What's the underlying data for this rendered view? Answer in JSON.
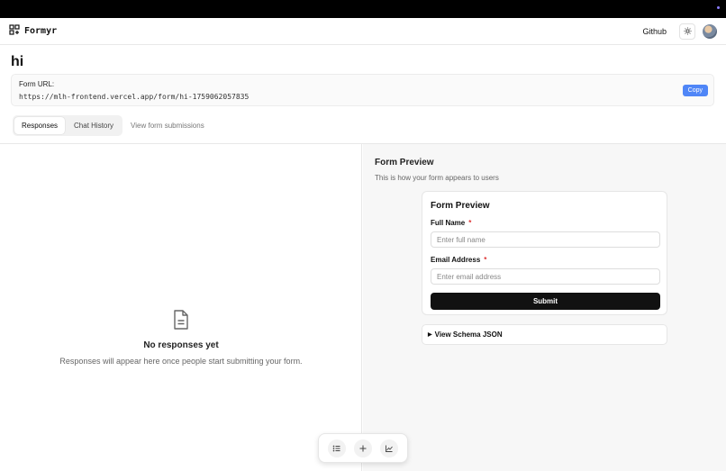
{
  "nav": {
    "brand": "Formyr",
    "github_label": "Github",
    "icons": [
      "grid-plus-icon",
      "sun-icon",
      "avatar"
    ]
  },
  "page": {
    "title": "hi",
    "url_label": "Form URL:",
    "url_value": "https://mlh-frontend.vercel.app/form/hi-1759062057835",
    "copy_label": "Copy"
  },
  "tabs": {
    "items": [
      {
        "label": "Responses",
        "active": true
      },
      {
        "label": "Chat History",
        "active": false
      }
    ],
    "subtitle": "View form submissions"
  },
  "empty_state": {
    "icon": "document-icon",
    "title": "No responses yet",
    "subtitle": "Responses will appear here once people start submitting your form."
  },
  "preview": {
    "title": "Form Preview",
    "subtitle": "This is how your form appears to users",
    "form": {
      "title": "Form Preview",
      "fields": [
        {
          "label": "Full Name",
          "required_mark": "*",
          "placeholder": "Enter full name"
        },
        {
          "label": "Email Address",
          "required_mark": "*",
          "placeholder": "Enter email address"
        }
      ],
      "submit_label": "Submit"
    },
    "schema_label": "View Schema JSON",
    "schema_marker": "▶"
  },
  "dock": {
    "icons": [
      "list-icon",
      "plus-icon",
      "chart-icon"
    ]
  },
  "colors": {
    "accent": "#4f86f7",
    "primary_button": "#111111",
    "required": "#dd3333"
  }
}
